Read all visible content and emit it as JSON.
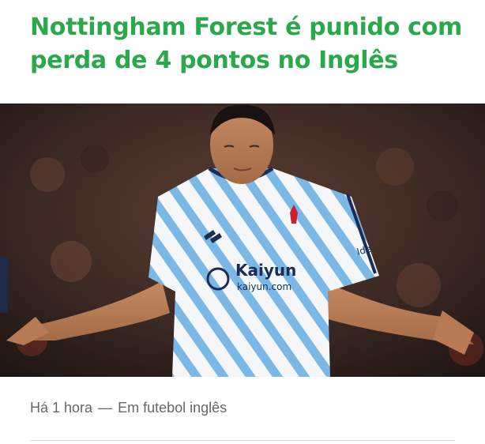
{
  "article": {
    "headline": "Nottingham Forest é punido com perda de 4 pontos no Inglês",
    "time_ago": "Há 1 hora",
    "separator": "—",
    "category_text": "Em futebol inglês"
  },
  "hero_image": {
    "sponsor_name": "Kaiyun",
    "sponsor_url": "kaiyun.com",
    "sleeve_text": "Ide"
  },
  "colors": {
    "headline": "#2aa84a",
    "meta_text": "#666666",
    "jersey_stripe": "#7ab8e6"
  }
}
